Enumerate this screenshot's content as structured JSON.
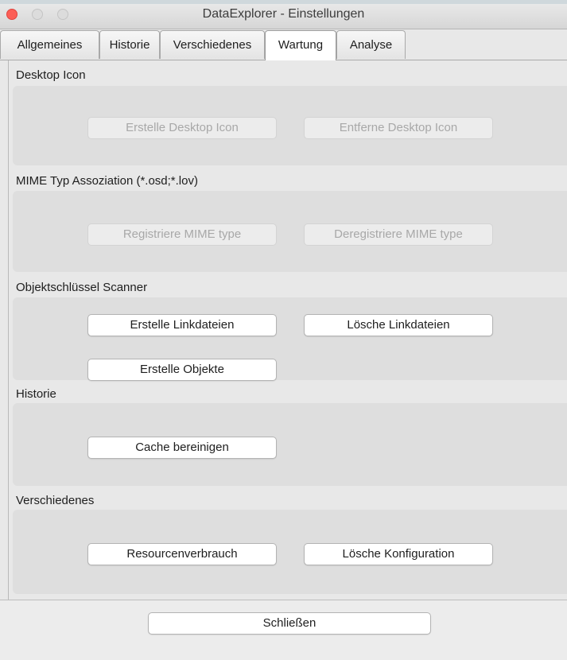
{
  "window": {
    "title": "DataExplorer - Einstellungen"
  },
  "tabs": [
    {
      "label": "Allgemeines",
      "active": false
    },
    {
      "label": "Historie",
      "active": false
    },
    {
      "label": "Verschiedenes",
      "active": false
    },
    {
      "label": "Wartung",
      "active": true
    },
    {
      "label": "Analyse",
      "active": false
    }
  ],
  "sections": {
    "desktop_icon": {
      "title": "Desktop Icon",
      "create_label": "Erstelle Desktop Icon",
      "remove_label": "Entferne Desktop Icon"
    },
    "mime": {
      "title": "MIME Typ Assoziation (*.osd;*.lov)",
      "register_label": "Registriere MIME type",
      "unregister_label": "Deregistriere MIME type"
    },
    "scanner": {
      "title": "Objektschlüssel Scanner",
      "create_links_label": "Erstelle Linkdateien",
      "delete_links_label": "Lösche Linkdateien",
      "create_objects_label": "Erstelle Objekte"
    },
    "history": {
      "title": "Historie",
      "clear_cache_label": "Cache bereinigen"
    },
    "misc": {
      "title": "Verschiedenes",
      "resources_label": "Resourcenverbrauch",
      "delete_config_label": "Lösche Konfiguration"
    }
  },
  "footer": {
    "close_label": "Schließen"
  },
  "colors": {
    "close_traffic_light": "#fc5f57",
    "section_background": "#dedede",
    "disabled_text": "#a8a8a8"
  }
}
